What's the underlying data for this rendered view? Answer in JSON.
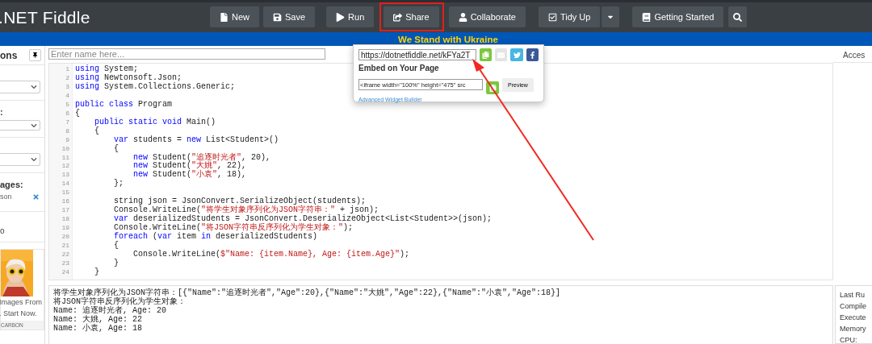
{
  "header": {
    "logo": ".NET Fiddle",
    "buttons": [
      {
        "kind": "file",
        "label": "New",
        "highlighted": false
      },
      {
        "kind": "save",
        "label": "Save",
        "highlighted": false
      },
      {
        "kind": "run",
        "label": "Run",
        "highlighted": false
      },
      {
        "kind": "share",
        "label": "Share",
        "highlighted": true
      },
      {
        "kind": "user",
        "label": "Collaborate",
        "highlighted": false
      },
      {
        "kind": "check",
        "label": "Tidy Up",
        "highlighted": false
      },
      {
        "kind": "caret",
        "highlighted": false
      },
      {
        "kind": "book",
        "label": "Getting Started",
        "highlighted": false
      },
      {
        "kind": "search",
        "highlighted": false
      }
    ]
  },
  "banner": "We Stand with Ukraine",
  "sidebar": {
    "title": "ons",
    "sections": [
      {
        "kind": "select"
      },
      {
        "kind": "select",
        "label": ":"
      },
      {
        "kind": "select"
      },
      {
        "kind": "packages",
        "label": "ages:",
        "items": [
          "son"
        ]
      },
      {
        "kind": "text",
        "label": "o"
      }
    ],
    "ad": {
      "lines": [
        "Images From",
        ". Start Now."
      ],
      "footer": "CARBON"
    }
  },
  "editor": {
    "name_placeholder": "Enter name here...",
    "lines": [
      {
        "number": "1",
        "code": [
          {
            "kind": "kw",
            "text": "using"
          },
          {
            "kind": "plain",
            "text": " System;"
          }
        ]
      },
      {
        "number": "2",
        "code": [
          {
            "kind": "kw",
            "text": "using"
          },
          {
            "kind": "plain",
            "text": " Newtonsoft.Json;"
          }
        ]
      },
      {
        "number": "3",
        "code": [
          {
            "kind": "kw",
            "text": "using"
          },
          {
            "kind": "plain",
            "text": " System.Collections.Generic;"
          }
        ]
      },
      {
        "number": "4"
      },
      {
        "number": "5",
        "code": [
          {
            "kind": "kw",
            "text": "public class"
          },
          {
            "kind": "plain",
            "text": " Program"
          }
        ]
      },
      {
        "number": "6",
        "code": [
          {
            "kind": "plain",
            "text": "{"
          }
        ]
      },
      {
        "number": "7",
        "code": [
          {
            "kind": "kw",
            "text": "    public static void"
          },
          {
            "kind": "plain",
            "text": " Main()"
          }
        ]
      },
      {
        "number": "8",
        "code": [
          {
            "kind": "plain",
            "text": "    {"
          }
        ]
      },
      {
        "number": "9",
        "code": [
          {
            "kind": "kw",
            "text": "        var"
          },
          {
            "kind": "plain",
            "text": " students = "
          },
          {
            "kind": "kw",
            "text": "new"
          },
          {
            "kind": "plain",
            "text": " List<Student>()"
          }
        ]
      },
      {
        "number": "10",
        "code": [
          {
            "kind": "plain",
            "text": "        {"
          }
        ]
      },
      {
        "number": "11",
        "code": [
          {
            "kind": "kw",
            "text": "            new"
          },
          {
            "kind": "plain",
            "text": " Student("
          },
          {
            "kind": "str",
            "text": "\"追逐时光者\""
          },
          {
            "kind": "plain",
            "text": ", 20),"
          }
        ]
      },
      {
        "number": "12",
        "code": [
          {
            "kind": "kw",
            "text": "            new"
          },
          {
            "kind": "plain",
            "text": " Student("
          },
          {
            "kind": "str",
            "text": "\"大姚\""
          },
          {
            "kind": "plain",
            "text": ", 22),"
          }
        ]
      },
      {
        "number": "13",
        "code": [
          {
            "kind": "kw",
            "text": "            new"
          },
          {
            "kind": "plain",
            "text": " Student("
          },
          {
            "kind": "str",
            "text": "\"小袁\""
          },
          {
            "kind": "plain",
            "text": ", 18),"
          }
        ]
      },
      {
        "number": "14",
        "code": [
          {
            "kind": "plain",
            "text": "        };"
          }
        ]
      },
      {
        "number": "15"
      },
      {
        "number": "16",
        "code": [
          {
            "kind": "plain",
            "text": "        string json = JsonConvert.SerializeObject(students);"
          }
        ]
      },
      {
        "number": "17",
        "code": [
          {
            "kind": "plain",
            "text": "        Console.WriteLine("
          },
          {
            "kind": "str",
            "text": "\"将学生对象序列化为JSON字符串：\""
          },
          {
            "kind": "plain",
            "text": " + json);"
          }
        ]
      },
      {
        "number": "18",
        "code": [
          {
            "kind": "kw",
            "text": "        var"
          },
          {
            "kind": "plain",
            "text": " deserializedStudents = JsonConvert.DeserializeObject<List<Student>>(json);"
          }
        ]
      },
      {
        "number": "19",
        "code": [
          {
            "kind": "plain",
            "text": "        Console.WriteLine("
          },
          {
            "kind": "str",
            "text": "\"将JSON字符串反序列化为学生对象：\""
          },
          {
            "kind": "plain",
            "text": ");"
          }
        ]
      },
      {
        "number": "20",
        "code": [
          {
            "kind": "kw",
            "text": "        foreach"
          },
          {
            "kind": "plain",
            "text": " ("
          },
          {
            "kind": "kw",
            "text": "var"
          },
          {
            "kind": "plain",
            "text": " item "
          },
          {
            "kind": "kw",
            "text": "in"
          },
          {
            "kind": "plain",
            "text": " deserializedStudents)"
          }
        ]
      },
      {
        "number": "21",
        "code": [
          {
            "kind": "plain",
            "text": "        {"
          }
        ]
      },
      {
        "number": "22",
        "code": [
          {
            "kind": "plain",
            "text": "            Console.WriteLine("
          },
          {
            "kind": "str",
            "text": "$\"Name: {item.Name}, Age: {item.Age}\""
          },
          {
            "kind": "plain",
            "text": ");"
          }
        ]
      },
      {
        "number": "23",
        "code": [
          {
            "kind": "plain",
            "text": "        }"
          }
        ]
      },
      {
        "number": "24",
        "code": [
          {
            "kind": "plain",
            "text": "    }"
          }
        ]
      }
    ]
  },
  "output": [
    "将学生对象序列化为JSON字符串：[{\"Name\":\"追逐时光者\",\"Age\":20},{\"Name\":\"大姚\",\"Age\":22},{\"Name\":\"小袁\",\"Age\":18}]",
    "将JSON字符串反序列化为学生对象：",
    "Name: 追逐时光者, Age: 20",
    "Name: 大姚, Age: 22",
    "Name: 小袁, Age: 18"
  ],
  "right_panel": {
    "title": "Acces",
    "stats": [
      "Last Ru",
      "Compile",
      "Execute",
      "Memory",
      "CPU:"
    ]
  },
  "share_popup": {
    "url": "https://dotnetfiddle.net/kFYa2T",
    "embed_title": "Embed on Your Page",
    "embed_code": "<iframe width=\"100%\" height=\"475\" src",
    "preview": "Preview",
    "link": "Advanced Widget Builder"
  }
}
